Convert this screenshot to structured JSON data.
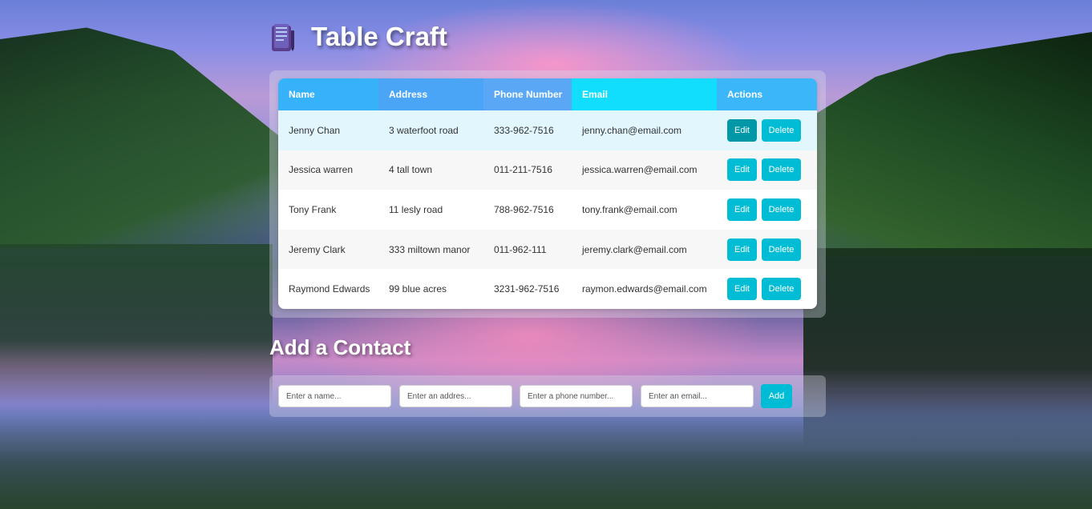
{
  "app": {
    "title": "Table Craft",
    "logo_icon": "clipboard-notes-icon"
  },
  "table": {
    "columns": [
      "Name",
      "Address",
      "Phone Number",
      "Email",
      "Actions"
    ],
    "rows": [
      {
        "name": "Jenny Chan",
        "address": "3 waterfoot road",
        "phone": "333-962-7516",
        "email": "jenny.chan@email.com"
      },
      {
        "name": "Jessica warren",
        "address": "4 tall town",
        "phone": "011-211-7516",
        "email": "jessica.warren@email.com"
      },
      {
        "name": "Tony Frank",
        "address": "11 lesly road",
        "phone": "788-962-7516",
        "email": "tony.frank@email.com"
      },
      {
        "name": "Jeremy Clark",
        "address": "333 miltown manor",
        "phone": "011-962-111",
        "email": "jeremy.clark@email.com"
      },
      {
        "name": "Raymond Edwards",
        "address": "99 blue acres",
        "phone": "3231-962-7516",
        "email": "raymon.edwards@email.com"
      }
    ],
    "edit_label": "Edit",
    "delete_label": "Delete"
  },
  "form": {
    "title": "Add a Contact",
    "name_placeholder": "Enter a name...",
    "address_placeholder": "Enter an addres...",
    "phone_placeholder": "Enter a phone number...",
    "email_placeholder": "Enter an email...",
    "add_label": "Add"
  },
  "colors": {
    "accent": "#00bcd4",
    "accent_active": "#0097a7",
    "header_gradient_start": "#46a8f8",
    "header_gradient_end": "#18e0ff"
  }
}
